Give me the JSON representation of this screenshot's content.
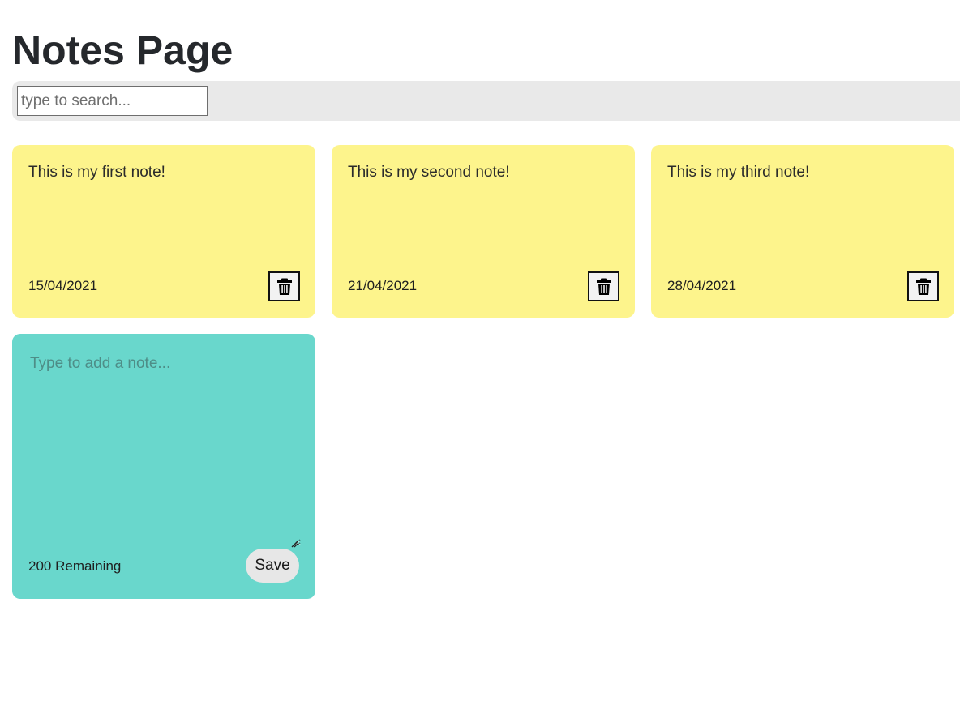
{
  "page": {
    "title": "Notes Page"
  },
  "search": {
    "placeholder": "type to search..."
  },
  "notes": [
    {
      "text": "This is my first note!",
      "date": "15/04/2021",
      "delete_icon": "trash-icon"
    },
    {
      "text": "This is my second note!",
      "date": "21/04/2021",
      "delete_icon": "trash-icon"
    },
    {
      "text": "This is my third note!",
      "date": "28/04/2021",
      "delete_icon": "trash-icon"
    }
  ],
  "new_note": {
    "placeholder": "Type to add a note...",
    "remaining": "200 Remaining",
    "save_label": "Save"
  },
  "colors": {
    "note_background": "#fdf48c",
    "new_note_background": "#69d7cc",
    "search_bar_background": "#e9e9e9"
  }
}
